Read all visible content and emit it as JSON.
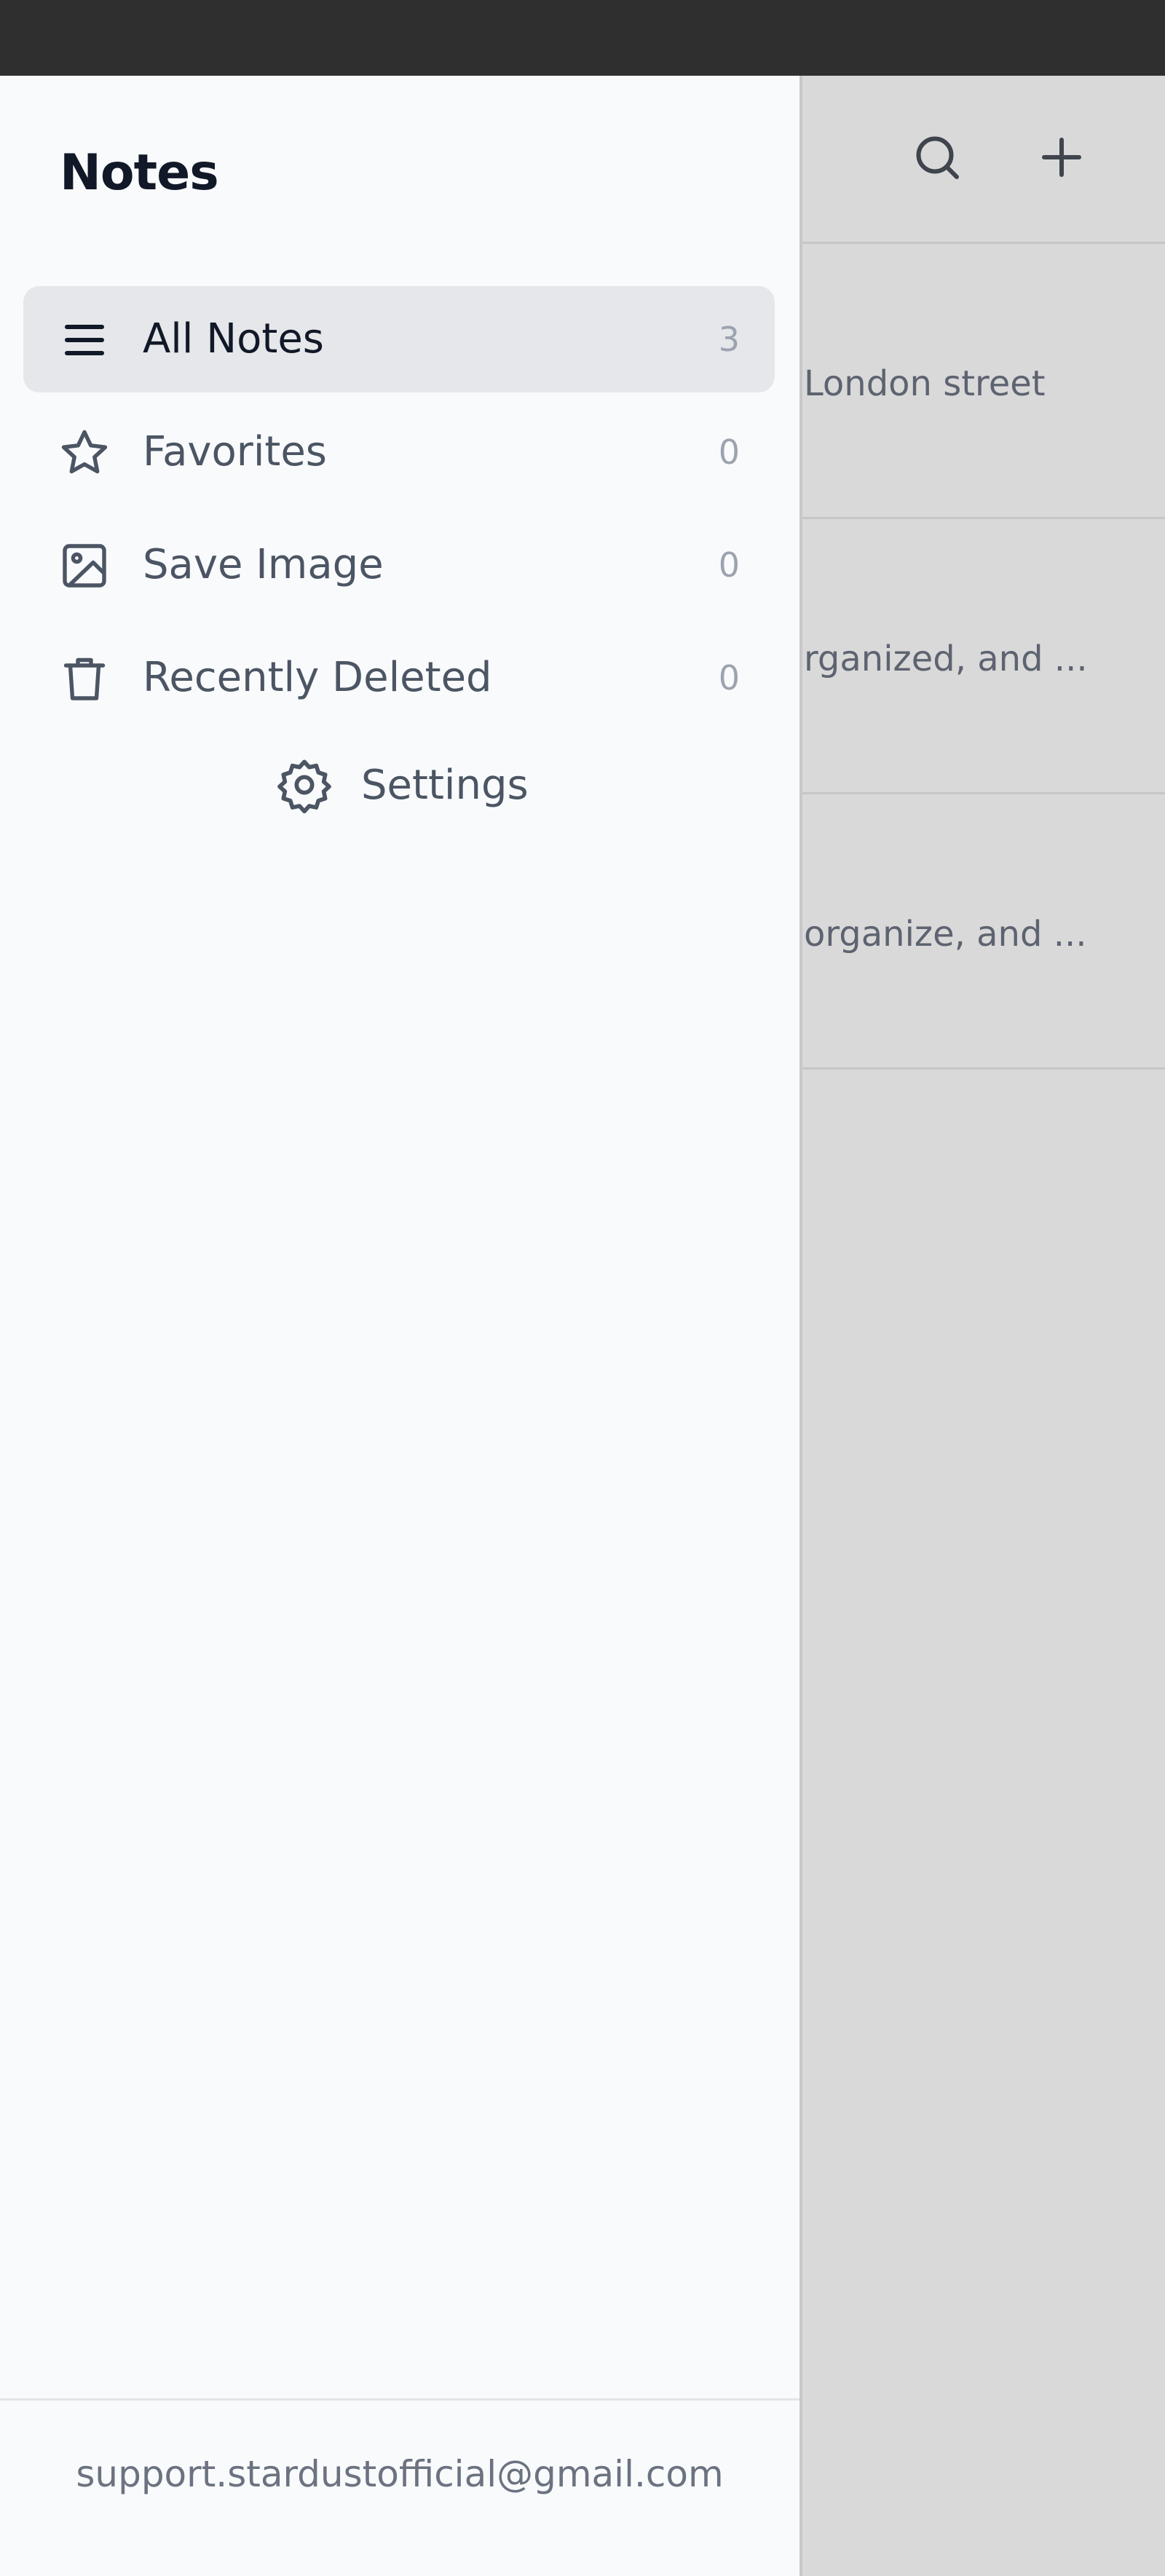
{
  "drawer": {
    "title": "Notes",
    "items": [
      {
        "label": "All Notes",
        "count": "3",
        "icon": "menu-lines-icon",
        "active": true
      },
      {
        "label": "Favorites",
        "count": "0",
        "icon": "star-icon",
        "active": false
      },
      {
        "label": "Save Image",
        "count": "0",
        "icon": "image-icon",
        "active": false
      },
      {
        "label": "Recently Deleted",
        "count": "0",
        "icon": "trash-icon",
        "active": false
      }
    ],
    "settings_label": "Settings",
    "footer_email": "support.stardustofficial@gmail.com"
  },
  "background": {
    "header_icons": [
      "search-icon",
      "plus-icon"
    ],
    "notes": [
      {
        "snippet": "London street"
      },
      {
        "snippet": "rganized, and ..."
      },
      {
        "snippet": "organize, and ..."
      }
    ]
  },
  "colors": {
    "drawer_bg": "#f9fafc",
    "active_item_bg": "#e6e7ea",
    "title_text": "#111827",
    "item_text": "#4b5563",
    "count_text": "#9ca3af",
    "status_bar": "#2f2f2f",
    "overlay_bg": "#d9d9d9"
  }
}
